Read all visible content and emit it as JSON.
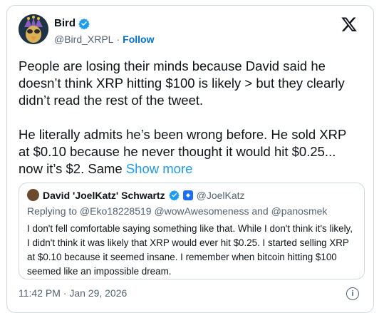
{
  "author": {
    "name": "Bird",
    "handle": "@Bird_XRPL",
    "follow_label": "Follow",
    "separator": "·"
  },
  "tweet": {
    "paragraph1": "People are losing their minds because David said he doesn’t think XRP hitting $100 is likely > but they clearly didn’t read the rest of the tweet.",
    "paragraph2": "He literally admits he’s been wrong before. He sold XRP at $0.10 because he never thought it would hit $0.25... now it’s $2. Same ",
    "show_more": "Show more"
  },
  "quoted": {
    "name": "David 'JoelKatz' Schwartz",
    "handle": "@JoelKatz",
    "replying_to": "Replying to @Eko18228519 @wowAwesomeness and @panosmek",
    "text": "I don't fell comfortable saying something like that. While I don't think it's likely, I didn't think it was likely that XRP would ever hit $0.25. I started selling XRP at $0.10 because it seemed insane. I remember when bitcoin hitting $100 seemed like an impossible dream."
  },
  "timestamp": "11:42 PM · Jan 29, 2026",
  "icons": {
    "platform": "x-logo-icon",
    "verified": "verified-badge-icon",
    "info": "info-icon"
  },
  "colors": {
    "link": "#1d9bf0",
    "follow": "#006fd6",
    "verified": "#1d9bf0",
    "border": "#cfd9de",
    "muted": "#536471"
  }
}
